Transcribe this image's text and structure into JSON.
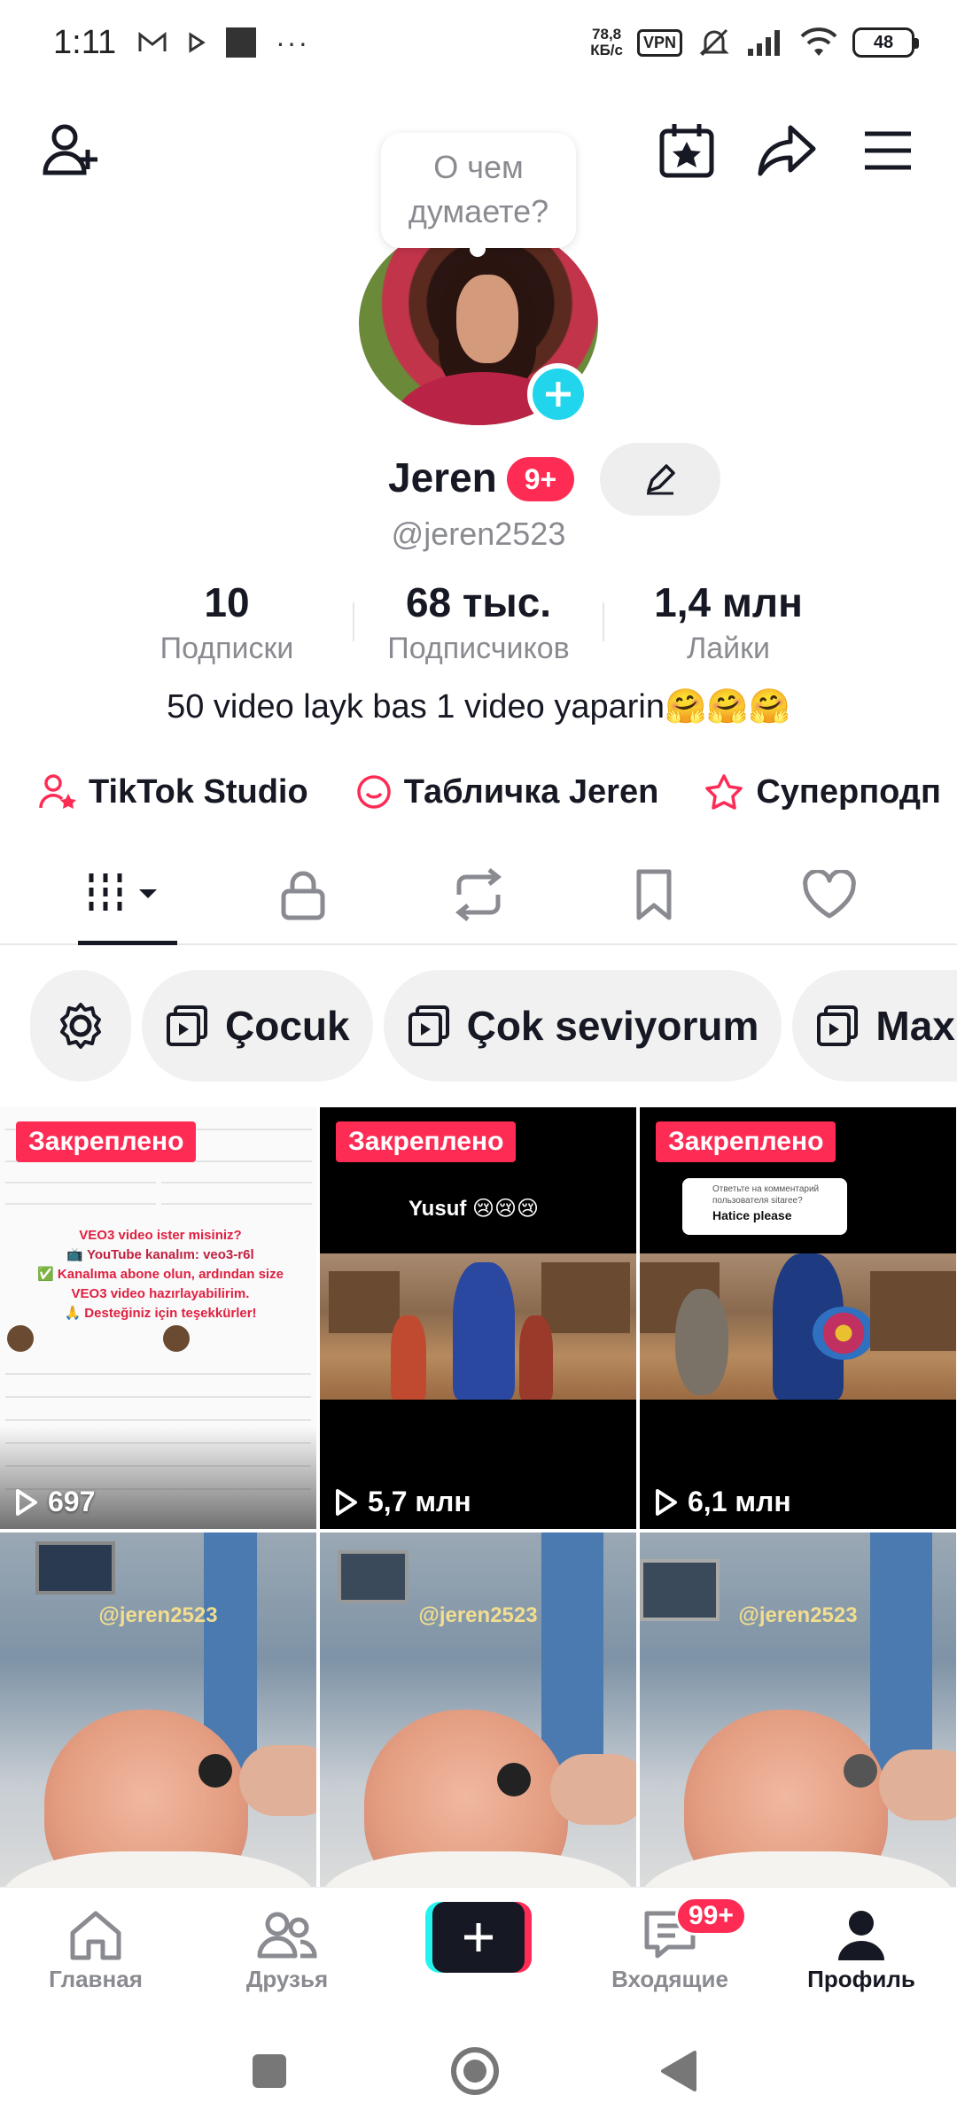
{
  "status_bar": {
    "time": "1:11",
    "net_speed_value": "78,8",
    "net_speed_unit": "КБ/с",
    "vpn": "VPN",
    "battery": "48"
  },
  "header": {
    "icons": [
      "add-friend-icon",
      "calendar-star-icon",
      "share-icon",
      "menu-icon"
    ]
  },
  "profile": {
    "bubble_text": "О чем думаете?",
    "name": "Jeren",
    "notifications_badge": "9+",
    "handle": "@jeren2523",
    "stats": [
      {
        "value": "10",
        "label": "Подписки"
      },
      {
        "value": "68 тыс.",
        "label": "Подписчиков"
      },
      {
        "value": "1,4 млн",
        "label": "Лайки"
      }
    ],
    "bio": "50 video layk bas 1 video yaparin🤗🤗🤗",
    "links": [
      {
        "label": "TikTok Studio",
        "icon": "person-star-icon",
        "color": "#fe2c55"
      },
      {
        "label": "Табличка Jeren",
        "icon": "chat-board-icon",
        "color": "#fe2c55"
      },
      {
        "label": "Суперподп",
        "icon": "star-tag-icon",
        "color": "#fe2c55"
      }
    ]
  },
  "tabs": [
    "videos-grid-icon",
    "lock-icon",
    "repost-icon",
    "bookmark-icon",
    "heart-icon"
  ],
  "collections": [
    "Çocuk",
    "Çok seviyorum",
    "Maxin"
  ],
  "videos": [
    {
      "pinned": "Закреплено",
      "views": "697"
    },
    {
      "pinned": "Закреплено",
      "views": "5,7 млн",
      "caption": "Yusuf 😢😢😢"
    },
    {
      "pinned": "Закреплено",
      "views": "6,1 млн",
      "comment_title": "Ответьте на комментарий пользователя sitaree?",
      "comment_body": "Hatice please"
    },
    {
      "watermark": "@jeren2523"
    },
    {
      "watermark": "@jeren2523"
    },
    {
      "watermark": "@jeren2523"
    }
  ],
  "promo": {
    "line1": "VEO3 video ister misiniz?",
    "line2": "📺 YouTube kanalım: veo3-r6l",
    "line3": "✅ Kanalıma abone olun, ardından size",
    "line4": "VEO3 video hazırlayabilirim.",
    "line5": "🙏 Desteğiniz için teşekkürler!"
  },
  "bottom_nav": {
    "home": "Главная",
    "friends": "Друзья",
    "inbox": "Входящие",
    "inbox_badge": "99+",
    "profile": "Профиль"
  },
  "colors": {
    "accent": "#fe2c55",
    "cyan": "#25f4ee",
    "text": "#161823",
    "muted": "#8a8b91"
  }
}
